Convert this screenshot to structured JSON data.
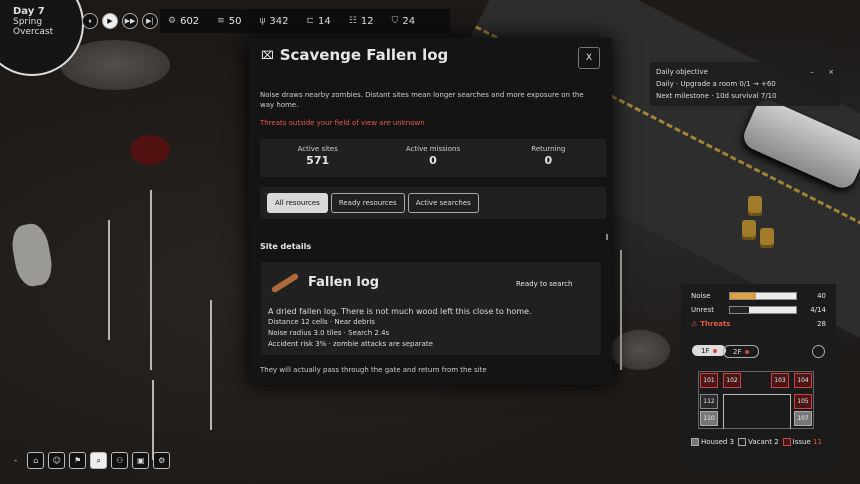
{
  "hud": {
    "day": "Day 7",
    "season": "Spring",
    "weather": "Overcast",
    "speed_controls": [
      "⏸",
      "▶",
      "▶▶",
      "▶|"
    ],
    "resources": [
      {
        "icon": "gear-icon",
        "glyph": "⚙",
        "value": "602"
      },
      {
        "icon": "wood-icon",
        "glyph": "≡",
        "value": "50"
      },
      {
        "icon": "food-icon",
        "glyph": "ψ",
        "value": "342"
      },
      {
        "icon": "bed-icon",
        "glyph": "⊏",
        "value": "14"
      },
      {
        "icon": "people-icon",
        "glyph": "☷",
        "value": "12"
      },
      {
        "icon": "shield-icon",
        "glyph": "⛉",
        "value": "24"
      }
    ]
  },
  "objective": {
    "title": "Daily objective",
    "minimize": "–",
    "close": "×",
    "line1": "Daily · Upgrade a room 0/1 → +60",
    "line2": "Next milestone · 10d survival 7/10"
  },
  "modal": {
    "title": "Scavenge Fallen log",
    "close": "X",
    "description": "Noise draws nearby zombies. Distant sites mean longer searches and more exposure on the way home.",
    "warning": "Threats outside your field of view are unknown",
    "stats": [
      {
        "label": "Active sites",
        "value": "571"
      },
      {
        "label": "Active missions",
        "value": "0"
      },
      {
        "label": "Returning",
        "value": "0"
      }
    ],
    "filters": [
      {
        "label": "All resources",
        "selected": true
      },
      {
        "label": "Ready resources",
        "selected": false
      },
      {
        "label": "Active searches",
        "selected": false
      }
    ],
    "section_title": "Site details",
    "site": {
      "name": "Fallen log",
      "status": "Ready to search",
      "lines": [
        "A dried fallen log. There is not much wood left this close to home.",
        "Distance 12 cells · Near debris",
        "Noise radius 3.0 tiles · Search 2.4s",
        "Accident risk 3% · zombie attacks are separate"
      ]
    },
    "footnote": "They will actually pass through the gate and return from the site"
  },
  "threat_panel": {
    "noise": {
      "label": "Noise",
      "value": "40",
      "fill": 0.4,
      "color": "#e0a040"
    },
    "unrest": {
      "label": "Unrest",
      "value": "4/14",
      "fill": 0.29,
      "color": "#222222"
    },
    "threats": {
      "label": "Threats",
      "value": "28"
    },
    "floors": [
      "1F",
      "2F"
    ],
    "rooms": [
      {
        "id": "101",
        "state": "issue"
      },
      {
        "id": "102",
        "state": "issue"
      },
      {
        "id": "103",
        "state": "issue"
      },
      {
        "id": "104",
        "state": "issue"
      },
      {
        "id": "112",
        "state": "vacant"
      },
      {
        "id": "105",
        "state": "issue"
      },
      {
        "id": "110",
        "state": "housed"
      },
      {
        "id": "107",
        "state": "housed"
      }
    ],
    "legend": {
      "housed_label": "Housed",
      "housed_count": "3",
      "vacant_label": "Vacant",
      "vacant_count": "2",
      "issue_label": "Issue",
      "issue_count": "11"
    }
  },
  "bottombar": {
    "dash": "-",
    "buttons": [
      {
        "icon": "build-icon",
        "glyph": "⌂"
      },
      {
        "icon": "smile-icon",
        "glyph": "☺"
      },
      {
        "icon": "flag-icon",
        "glyph": "⚑"
      },
      {
        "icon": "search-icon",
        "glyph": "⌕"
      },
      {
        "icon": "people-search-icon",
        "glyph": "⚇"
      },
      {
        "icon": "monitor-icon",
        "glyph": "▣"
      },
      {
        "icon": "settings-icon",
        "glyph": "⚙"
      }
    ]
  }
}
